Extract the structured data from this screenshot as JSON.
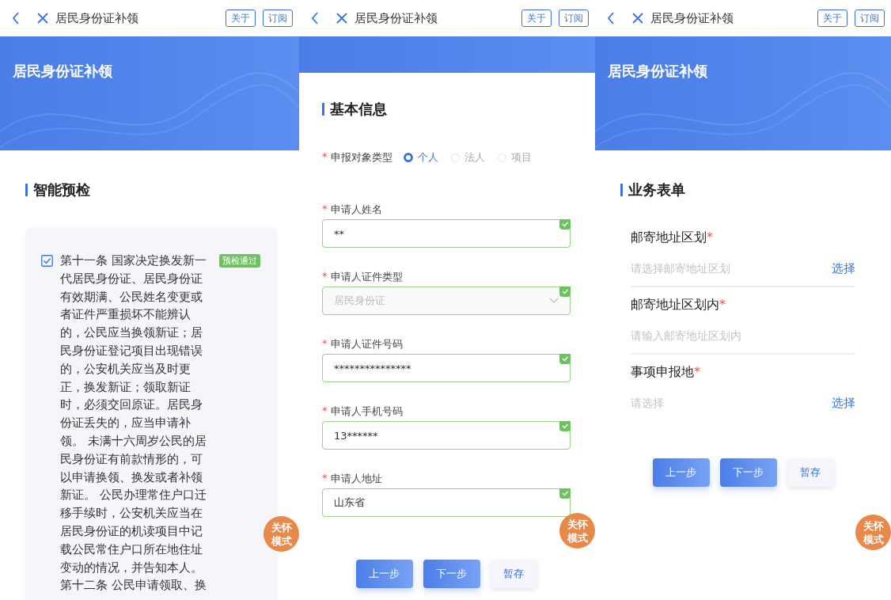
{
  "screens": [
    {
      "kind": "precheck",
      "top_bar": {
        "title": "居民身份证补领",
        "buttons": [
          "关于",
          "订阅"
        ]
      },
      "banner_title": "居民身份证补领",
      "section_title": "智能预检",
      "items": [
        {
          "checked": true,
          "text": "第十一条 国家决定换发新一代居民身份证、居民身份证有效期满、公民姓名变更或者证件严重损坏不能辨认的，公民应当换领新证；居民身份证登记项目出现错误的，公安机关应当及时更正，换发新证；领取新证时，必须交回原证。居民身份证丢失的，应当申请补领。 未满十六周岁公民的居民身份证有前款情形的，可以申请换领、换发或者补领新证。 公民办理常住户口迁移手续时，公安机关应当在居民身份证的机读项目中记载公民常住户口所在地住址变动的情况，并告知本人。第十二条 公民申请领取、换",
          "badge": "预检通过"
        }
      ],
      "care_button": "关怀模式"
    },
    {
      "kind": "form",
      "top_bar": {
        "title": "居民身份证补领",
        "buttons": [
          "关于",
          "订阅"
        ]
      },
      "section_title": "基本信息",
      "fields": [
        {
          "kind": "radio",
          "asterisk": "*",
          "label": "申报对象类型",
          "options": [
            {
              "label": "个人",
              "selected": true
            },
            {
              "label": "法人",
              "selected": false
            },
            {
              "label": "项目",
              "selected": false
            }
          ]
        },
        {
          "kind": "text",
          "asterisk": "*",
          "label": "申请人姓名",
          "value": "**",
          "valid": true,
          "disabled": false
        },
        {
          "kind": "select",
          "asterisk": "*",
          "label": "申请人证件类型",
          "value": "居民身份证",
          "valid": true,
          "disabled": true
        },
        {
          "kind": "text",
          "asterisk": "*",
          "label": "申请人证件号码",
          "value": "***************",
          "valid": true,
          "disabled": false
        },
        {
          "kind": "text",
          "asterisk": "*",
          "label": "申请人手机号码",
          "value": "13******",
          "valid": true,
          "disabled": false
        },
        {
          "kind": "text",
          "asterisk": "*",
          "label": "申请人地址",
          "value": "山东省",
          "valid": true,
          "disabled": false
        }
      ],
      "buttons": [
        {
          "label": "上一步",
          "kind": "primary"
        },
        {
          "label": "下一步",
          "kind": "primary"
        },
        {
          "label": "暂存",
          "kind": "secondary"
        }
      ],
      "care_button": "关怀模式"
    },
    {
      "kind": "business",
      "top_bar": {
        "title": "居民身份证补领",
        "buttons": [
          "关于",
          "订阅"
        ]
      },
      "banner_title": "居民身份证补领",
      "section_title": "业务表单",
      "fields": [
        {
          "kind": "picker",
          "label": "邮寄地址区划",
          "asterisk": "*",
          "placeholder": "请选择邮寄地址区划",
          "action": "选择"
        },
        {
          "kind": "input",
          "label": "邮寄地址区划内",
          "asterisk": "*",
          "placeholder": "请输入邮寄地址区划内"
        },
        {
          "kind": "picker",
          "label": "事项申报地",
          "asterisk": "*",
          "placeholder": "请选择",
          "action": "选择"
        }
      ],
      "buttons": [
        {
          "label": "上一步",
          "kind": "primary"
        },
        {
          "label": "下一步",
          "kind": "primary"
        },
        {
          "label": "暂存",
          "kind": "secondary"
        }
      ],
      "care_button": "关怀模式"
    }
  ]
}
